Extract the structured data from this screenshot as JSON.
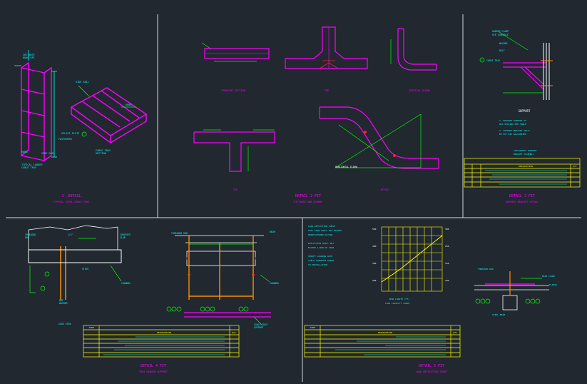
{
  "colors": {
    "background": "#212830",
    "frame": "#d8d8d8",
    "magenta": "#ff00ff",
    "cyan": "#00ffff",
    "green": "#00ff00",
    "yellow": "#ffff00",
    "red": "#ff2020",
    "orange": "#ff8c00",
    "white": "#ffffff"
  },
  "panels": {
    "detail_1": {
      "title": "1 .DETAIL",
      "subtitle": "TYPICAL STEEL CABLE TRAY"
    },
    "detail_2": {
      "title": "DETAIL 2 FIT",
      "subtitle": "FITTINGS AND ELBOWS",
      "labels": {
        "straight": "STRAIGHT SECTION",
        "tee": "TEE",
        "elbow_vertical": "VERTICAL ELBOW",
        "tee_lower": "TEE",
        "horizontal_elbow": "HORIZONTAL ELBOW",
        "offset": "OFFSET"
      }
    },
    "detail_3": {
      "title": "DETAIL 3 FIT",
      "subtitle": "SUPPORT BRACKET DETAIL",
      "notes_heading": "SUPPORT",
      "table_header": [
        "DESCRIPTION",
        "QTY"
      ]
    },
    "detail_4": {
      "title": "DETAIL 4 FIT",
      "subtitle": "TRAY HANGER SUPPORT",
      "table_header": [
        "ITEM",
        "DESCRIPTION",
        "QTY"
      ]
    },
    "detail_5": {
      "title": "DETAIL 5 FIT",
      "subtitle": "LOAD DEFLECTION CHART",
      "table_header": [
        "ITEM",
        "DESCRIPTION",
        "QTY"
      ]
    }
  }
}
